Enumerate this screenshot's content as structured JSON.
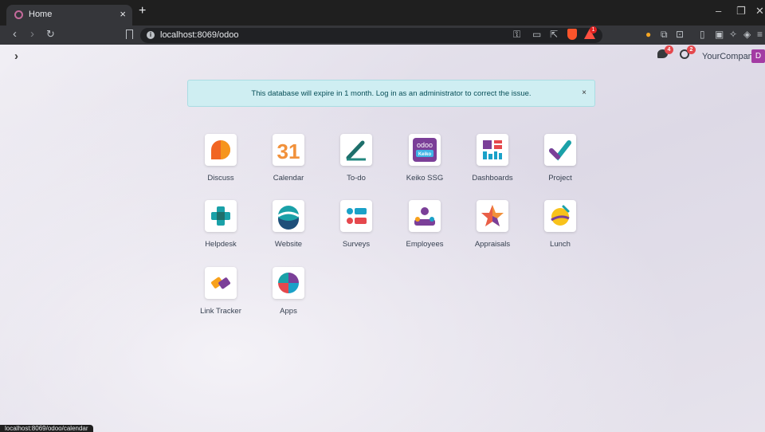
{
  "browser": {
    "tab_title": "Home",
    "tab_close": "×",
    "new_tab": "+",
    "url": "localhost:8069/odoo",
    "window": {
      "minimize": "–",
      "restore": "❐",
      "close": "✕"
    },
    "extension_badge": "1",
    "status_url": "localhost:8069/odoo/calendar"
  },
  "navbar": {
    "menu_toggle": "›",
    "messages_badge": "4",
    "activities_badge": "2",
    "company": "YourCompany",
    "avatar_letter": "D"
  },
  "alert": {
    "message": "This database will expire in 1 month. Log in as an administrator to correct the issue.",
    "close": "×"
  },
  "apps": [
    {
      "label": "Discuss",
      "icon": "discuss-icon"
    },
    {
      "label": "Calendar",
      "icon": "calendar-icon",
      "icon_text": "31"
    },
    {
      "label": "To-do",
      "icon": "todo-icon"
    },
    {
      "label": "Keiko SSG",
      "icon": "keiko-ssg-icon",
      "icon_text": "odoo",
      "icon_subtext": "Keiko"
    },
    {
      "label": "Dashboards",
      "icon": "dashboards-icon"
    },
    {
      "label": "Project",
      "icon": "project-icon"
    },
    {
      "label": "Helpdesk",
      "icon": "helpdesk-icon"
    },
    {
      "label": "Website",
      "icon": "website-icon"
    },
    {
      "label": "Surveys",
      "icon": "surveys-icon"
    },
    {
      "label": "Employees",
      "icon": "employees-icon"
    },
    {
      "label": "Appraisals",
      "icon": "appraisals-icon"
    },
    {
      "label": "Lunch",
      "icon": "lunch-icon"
    },
    {
      "label": "Link Tracker",
      "icon": "link-tracker-icon"
    },
    {
      "label": "Apps",
      "icon": "apps-icon"
    }
  ]
}
